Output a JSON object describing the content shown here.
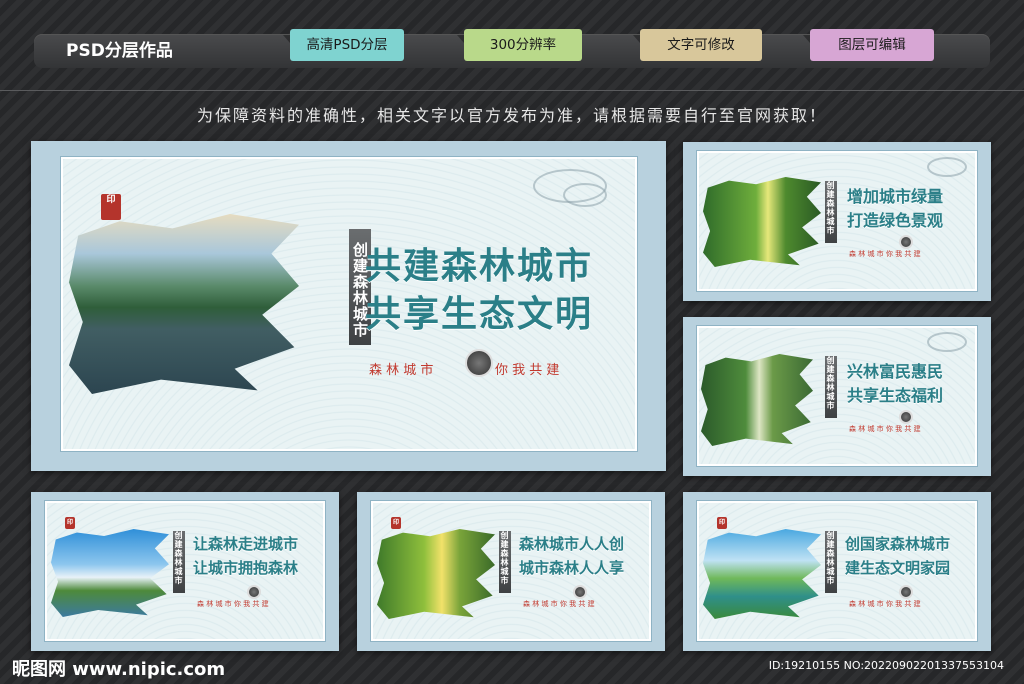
{
  "header": {
    "brand": "PSD分层作品",
    "tags": [
      {
        "label": "高清PSD分层",
        "color": "#7fd3d0"
      },
      {
        "label": "300分辨率",
        "color": "#b9d98a"
      },
      {
        "label": "文字可修改",
        "color": "#d8c79b"
      },
      {
        "label": "图层可编辑",
        "color": "#d7a6d4"
      }
    ]
  },
  "notice": "为保障资料的准确性，相关文字以官方发布为准，请根据需要自行至官网获取！",
  "main_board": {
    "vertical": "创建森林城市",
    "line1": "共建森林城市",
    "line2": "共享生态文明",
    "slogan_left": "森 林 城 市",
    "slogan_right": "你 我 共 建"
  },
  "boards": [
    {
      "line1": "增加城市绿量",
      "line2": "打造绿色景观"
    },
    {
      "line1": "兴林富民惠民",
      "line2": "共享生态福利"
    },
    {
      "line1": "让森林走进城市",
      "line2": "让城市拥抱森林"
    },
    {
      "line1": "森林城市人人创",
      "line2": "城市森林人人享"
    },
    {
      "line1": "创国家森林城市",
      "line2": "建生态文明家园"
    }
  ],
  "small_slogan": "森 林 城 市   你 我 共 建",
  "footer": {
    "left": "昵图网 www.nipic.com",
    "right": "ID:19210155 NO:20220902201337553104"
  }
}
